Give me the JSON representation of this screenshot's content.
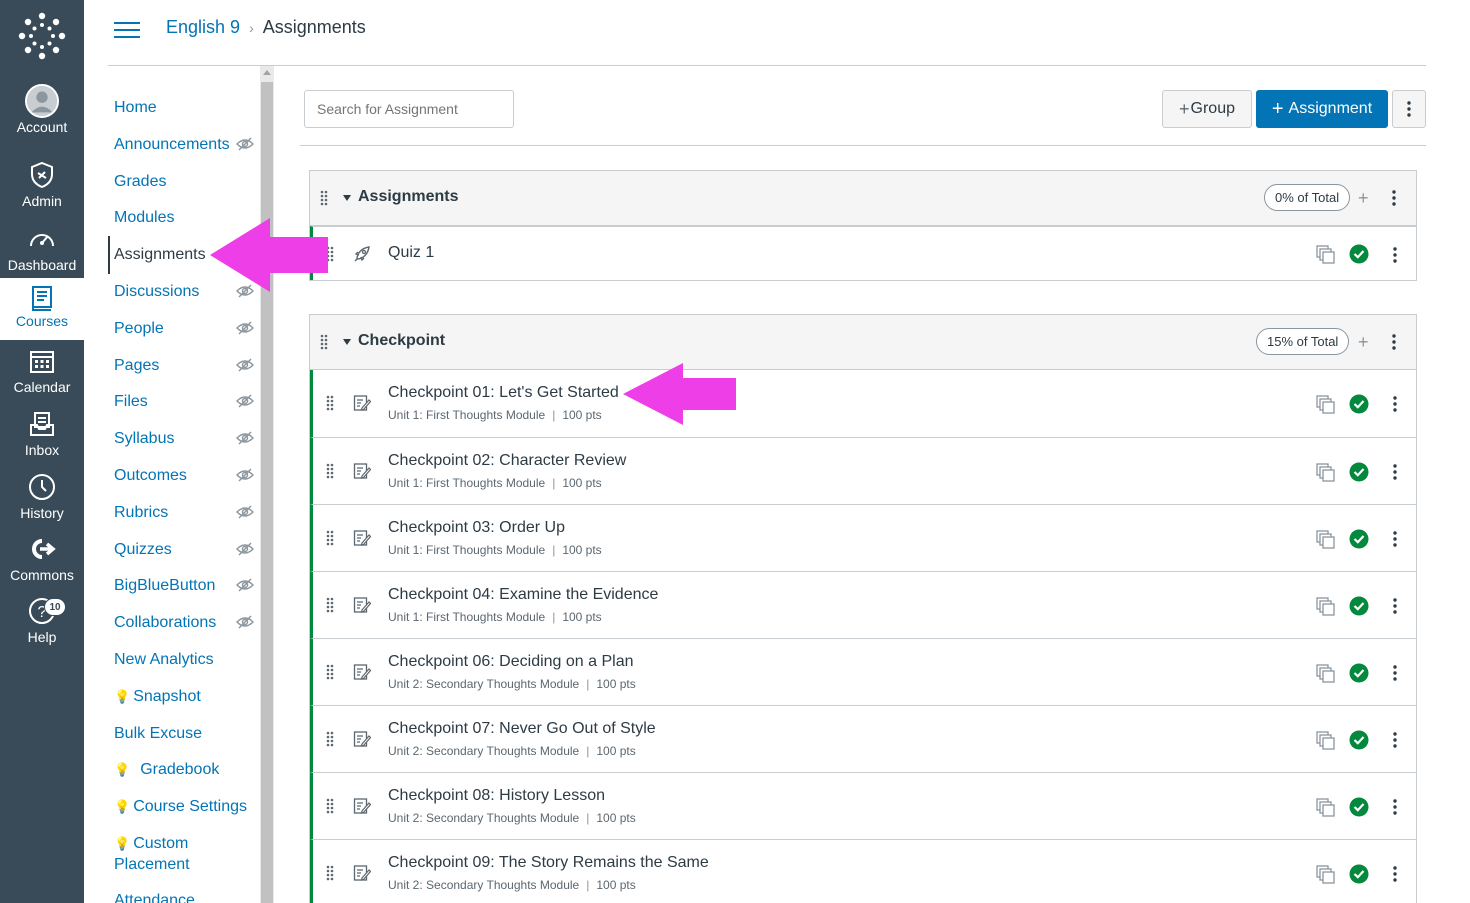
{
  "global_nav": {
    "items": [
      {
        "label": "Account",
        "icon": "account-avatar-icon"
      },
      {
        "label": "Admin",
        "icon": "shield-icon"
      },
      {
        "label": "Dashboard",
        "icon": "dashboard-gauge-icon"
      },
      {
        "label": "Courses",
        "icon": "book-icon"
      },
      {
        "label": "Calendar",
        "icon": "calendar-icon"
      },
      {
        "label": "Inbox",
        "icon": "inbox-icon"
      },
      {
        "label": "History",
        "icon": "clock-icon"
      },
      {
        "label": "Commons",
        "icon": "commons-icon"
      },
      {
        "label": "Help",
        "icon": "help-icon",
        "badge": "10"
      }
    ]
  },
  "header": {
    "course": "English 9",
    "current": "Assignments"
  },
  "course_nav": {
    "items": [
      {
        "label": "Home"
      },
      {
        "label": "Announcements"
      },
      {
        "label": "Grades"
      },
      {
        "label": "Modules"
      },
      {
        "label": "Assignments"
      },
      {
        "label": "Discussions"
      },
      {
        "label": "People"
      },
      {
        "label": "Pages"
      },
      {
        "label": "Files"
      },
      {
        "label": "Syllabus"
      },
      {
        "label": "Outcomes"
      },
      {
        "label": "Rubrics"
      },
      {
        "label": "Quizzes"
      },
      {
        "label": "BigBlueButton"
      },
      {
        "label": "Collaborations"
      },
      {
        "label": "New Analytics"
      },
      {
        "label": "Snapshot"
      },
      {
        "label": "Bulk Excuse"
      },
      {
        "label": "Gradebook"
      },
      {
        "label": "Course Settings"
      },
      {
        "label": "Custom"
      },
      {
        "label": "Placement"
      },
      {
        "label": "Attendance"
      }
    ]
  },
  "toolbar": {
    "search_placeholder": "Search for Assignment",
    "group_label": "Group",
    "assignment_label": "Assignment"
  },
  "groups": [
    {
      "title": "Assignments",
      "weight": "0% of Total",
      "items": [
        {
          "title": "Quiz 1"
        }
      ]
    },
    {
      "title": "Checkpoint",
      "weight": "15% of Total",
      "items": [
        {
          "title": "Checkpoint 01: Let's Get Started",
          "module": "Unit 1: First Thoughts Module",
          "points": "100 pts"
        },
        {
          "title": "Checkpoint 02: Character Review",
          "module": "Unit 1: First Thoughts Module",
          "points": "100 pts"
        },
        {
          "title": "Checkpoint 03: Order Up",
          "module": "Unit 1: First Thoughts Module",
          "points": "100 pts"
        },
        {
          "title": "Checkpoint 04: Examine the Evidence",
          "module": "Unit 1: First Thoughts Module",
          "points": "100 pts"
        },
        {
          "title": "Checkpoint 06: Deciding on a Plan",
          "module": "Unit 2: Secondary Thoughts Module",
          "points": "100 pts"
        },
        {
          "title": "Checkpoint 07: Never Go Out of Style",
          "module": "Unit 2: Secondary Thoughts Module",
          "points": "100 pts"
        },
        {
          "title": "Checkpoint 08: History Lesson",
          "module": "Unit 2: Secondary Thoughts Module",
          "points": "100 pts"
        },
        {
          "title": "Checkpoint 09: The Story Remains the Same",
          "module": "Unit 2: Secondary Thoughts Module",
          "points": "100 pts"
        }
      ]
    }
  ],
  "colors": {
    "nav_bg": "#394b58",
    "link": "#0374b5",
    "published": "#03893d",
    "annotation_arrow": "#ee3ee8"
  }
}
